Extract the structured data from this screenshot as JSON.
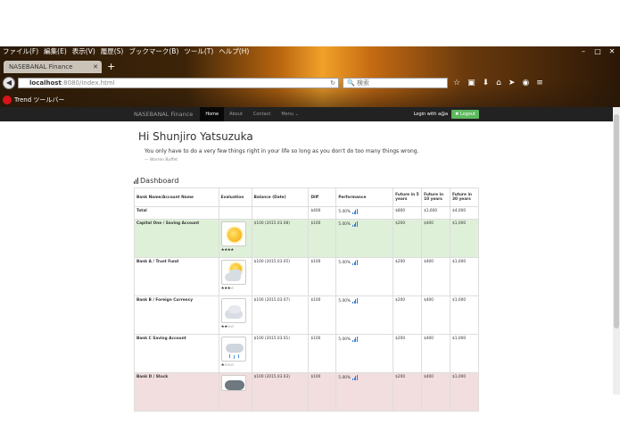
{
  "browser": {
    "menu": [
      "ファイル(F)",
      "編集(E)",
      "表示(V)",
      "履歴(S)",
      "ブックマーク(B)",
      "ツール(T)",
      "ヘルプ(H)"
    ],
    "tab_title": "NASEBANAL Finance",
    "url_host": "localhost",
    "url_path": ":8080/index.html",
    "search_placeholder": "検索",
    "trend_toolbar": "Trend ツールバー"
  },
  "nav": {
    "brand": "NASEBANAL Finance",
    "links": [
      "Home",
      "About",
      "Contact",
      "Menu ⌄"
    ],
    "login_label": "Login with a@a",
    "logout_label": "Logout"
  },
  "header": {
    "greeting": "Hi Shunjiro Yatsuzuka",
    "quote": "You only have to do a very few things right in your life so long as you don't do too many things wrong.",
    "quote_author": "— Warren Buffet"
  },
  "dashboard": {
    "title": "Dashboard",
    "columns": [
      "Bank Name/Account Name",
      "Evaluation",
      "Balance (Date)",
      "Diff",
      "Performance",
      "Future in 5 years",
      "Future in 10 years",
      "Future in 30 years"
    ],
    "total": {
      "name": "Total",
      "balance": "",
      "diff": "$400",
      "performance": "5.00%",
      "f5": "$800",
      "f10": "$1,600",
      "f30": "$4,000"
    },
    "rows": [
      {
        "name": "Capital One / Saving Account",
        "weather": "sun",
        "rating": "★★★★",
        "balance": "$100 (2015.03.08)",
        "diff": "$100",
        "performance": "5.00%",
        "f5": "$200",
        "f10": "$400",
        "f30": "$1,000",
        "status": "green"
      },
      {
        "name": "Bank A / Trust Fund",
        "weather": "partly-cloudy",
        "rating": "★★★☆",
        "balance": "$100 (2015.03.05)",
        "diff": "$100",
        "performance": "5.00%",
        "f5": "$200",
        "f10": "$400",
        "f30": "$1,000",
        "status": "none"
      },
      {
        "name": "Bank B / Foreign Currency",
        "weather": "cloudy",
        "rating": "★★☆☆",
        "balance": "$100 (2015.03.07)",
        "diff": "$100",
        "performance": "5.00%",
        "f5": "$200",
        "f10": "$400",
        "f30": "$1,000",
        "status": "none"
      },
      {
        "name": "Bank C Saving Account",
        "weather": "rain",
        "rating": "★☆☆☆",
        "balance": "$100 (2015.03.01)",
        "diff": "$100",
        "performance": "5.00%",
        "f5": "$200",
        "f10": "$400",
        "f30": "$1,000",
        "status": "none"
      },
      {
        "name": "Bank D / Stock",
        "weather": "storm",
        "rating": "",
        "balance": "$100 (2015.03.03)",
        "diff": "$100",
        "performance": "5.00%",
        "f5": "$200",
        "f10": "$400",
        "f30": "$1,000",
        "status": "red"
      }
    ]
  },
  "colors": {
    "success_row": "#dff0d8",
    "danger_row": "#f2dede",
    "navbar": "#222222",
    "logout": "#5cb85c"
  }
}
